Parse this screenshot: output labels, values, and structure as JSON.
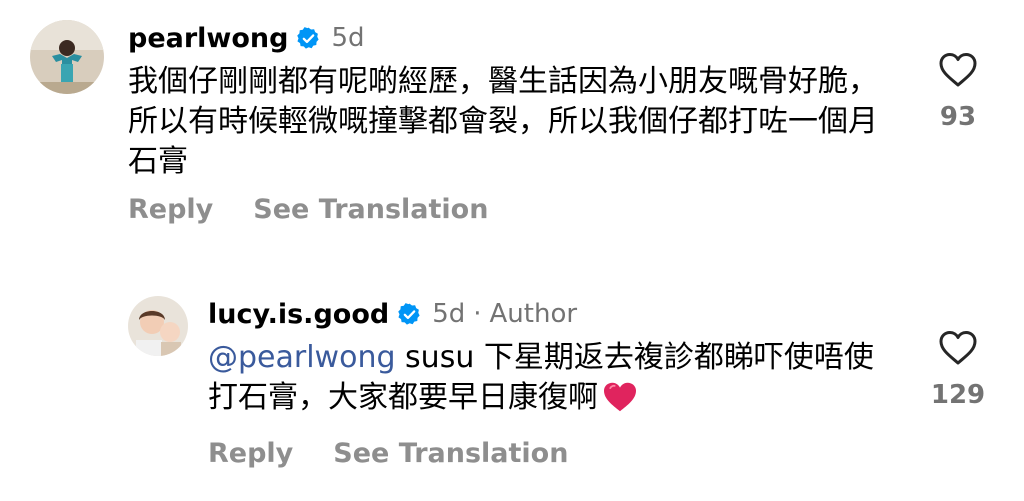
{
  "comments": [
    {
      "username": "pearlwong",
      "verified": true,
      "age": "5d",
      "text": "我個仔剛剛都有呢啲經歷，醫生話因為小朋友嘅骨好脆，所以有時候輕微嘅撞擊都會裂，所以我個仔都打咗一個月石膏",
      "reply_label": "Reply",
      "translation_label": "See Translation",
      "likes": "93",
      "heart_icon": "heart-outline-icon"
    },
    {
      "username": "lucy.is.good",
      "verified": true,
      "age": "5d",
      "separator": "·",
      "author_label": "Author",
      "mention": "@pearlwong",
      "text": "susu 下星期返去複診都睇吓使唔使打石膏，大家都要早日康復啊",
      "emoji": "red-heart-emoji",
      "reply_label": "Reply",
      "translation_label": "See Translation",
      "likes": "129",
      "heart_icon": "heart-outline-icon"
    }
  ],
  "colors": {
    "verified_blue": "#0095f6",
    "meta_gray": "#737373",
    "action_gray": "#8e8e8e",
    "mention_blue": "#3a5a9c",
    "emoji_red": "#e0245e"
  }
}
